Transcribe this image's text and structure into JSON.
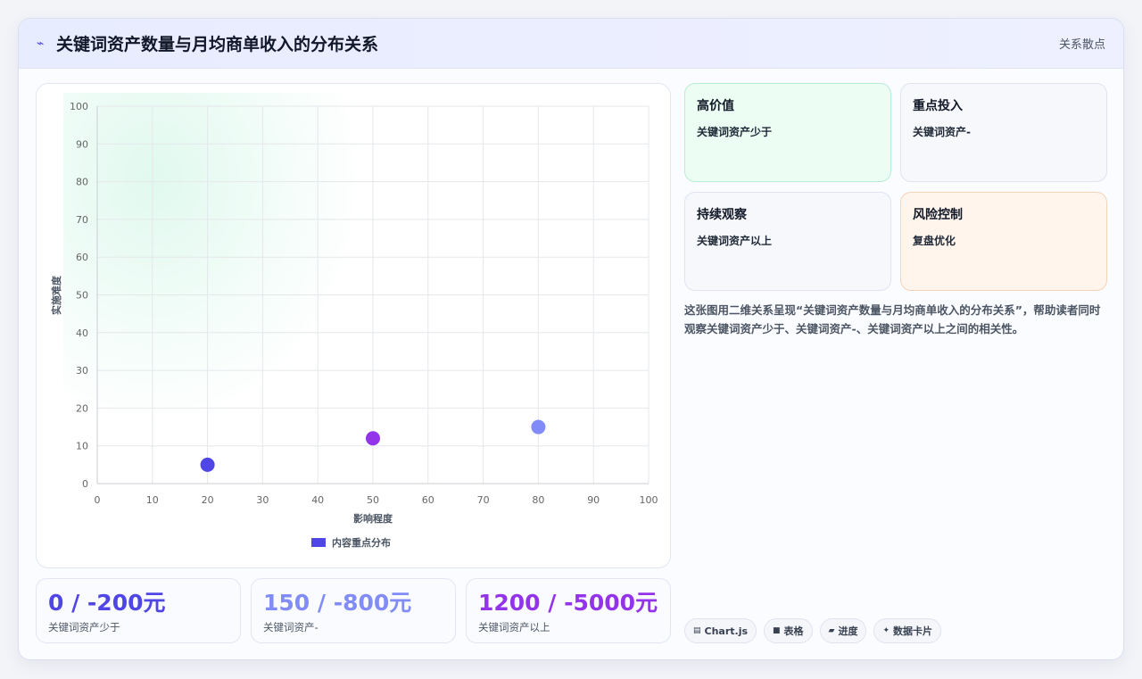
{
  "header": {
    "title": "关键词资产数量与月均商单收入的分布关系",
    "tag": "关系散点"
  },
  "chart_data": {
    "type": "scatter",
    "xlabel": "影响程度",
    "ylabel": "实施难度",
    "xlim": [
      0,
      100
    ],
    "ylim": [
      0,
      100
    ],
    "xticks": [
      0,
      10,
      20,
      30,
      40,
      50,
      60,
      70,
      80,
      90,
      100
    ],
    "yticks": [
      0,
      10,
      20,
      30,
      40,
      50,
      60,
      70,
      80,
      90,
      100
    ],
    "grid": true,
    "legend_position": "bottom",
    "series": [
      {
        "name": "内容重点分布",
        "color": "#4f46e5",
        "points": [
          {
            "x": 20,
            "y": 5,
            "color": "#4f46e5"
          },
          {
            "x": 50,
            "y": 12,
            "color": "#9333ea"
          },
          {
            "x": 80,
            "y": 15,
            "color": "#818cf8"
          }
        ]
      }
    ]
  },
  "stats": [
    {
      "value": "0 / -200元",
      "label": "关键词资产少于",
      "color": "#4f46e5"
    },
    {
      "value": "150 / -800元",
      "label": "关键词资产-",
      "color": "#818cf8"
    },
    {
      "value": "1200 / -5000元",
      "label": "关键词资产以上",
      "color": "#9333ea"
    }
  ],
  "quadrants": [
    {
      "title": "高价值",
      "desc": "关键词资产少于"
    },
    {
      "title": "重点投入",
      "desc": "关键词资产-"
    },
    {
      "title": "持续观察",
      "desc": "关键词资产以上"
    },
    {
      "title": "风险控制",
      "desc": "复盘优化"
    }
  ],
  "description": "这张图用二维关系呈现“关键词资产数量与月均商单收入的分布关系”，帮助读者同时观察关键词资产少于、关键词资产-、关键词资产以上之间的相关性。",
  "chips": [
    {
      "icon": "chart-icon",
      "label": "Chart.js"
    },
    {
      "icon": "table-icon",
      "label": "表格"
    },
    {
      "icon": "progress-icon",
      "label": "进度"
    },
    {
      "icon": "sparkle-icon",
      "label": "数据卡片"
    }
  ]
}
